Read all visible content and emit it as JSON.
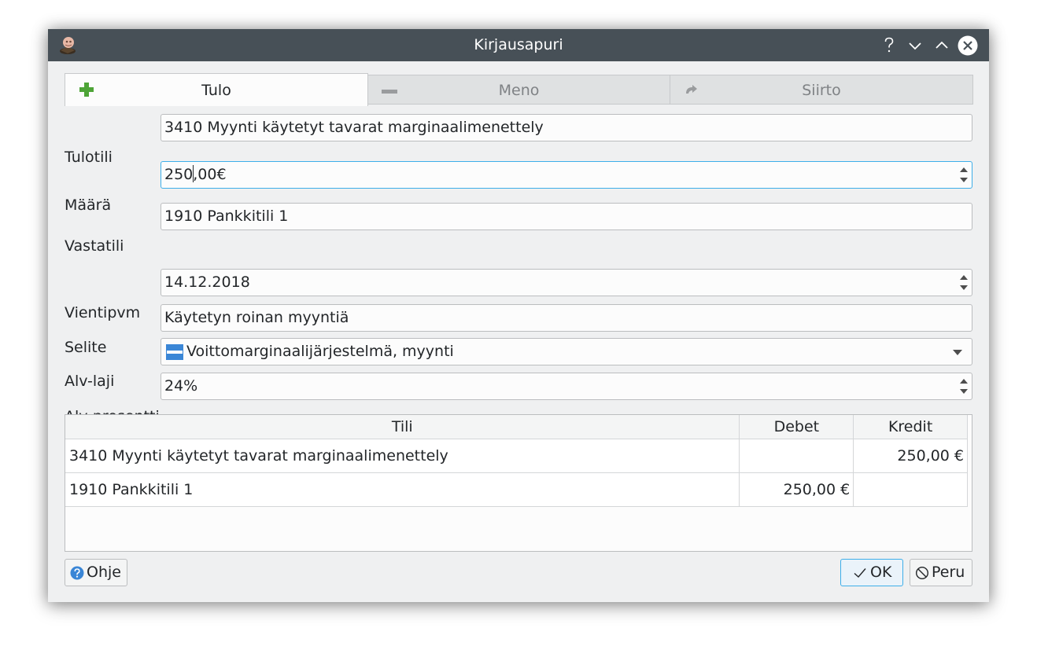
{
  "window": {
    "title": "Kirjausapuri",
    "controls": {
      "help": "?",
      "minimize": "chevron-down",
      "maximize": "chevron-up",
      "close": "close"
    }
  },
  "tabs": [
    {
      "label": "Tulo",
      "icon": "plus-icon",
      "active": true
    },
    {
      "label": "Meno",
      "icon": "minus-icon",
      "active": false
    },
    {
      "label": "Siirto",
      "icon": "transfer-icon",
      "active": false
    }
  ],
  "form": {
    "tulotili": {
      "label": "Tulotili",
      "value": "3410 Myynti käytetyt tavarat marginaalimenettely"
    },
    "maara": {
      "label": "Määrä",
      "value_before_cursor": "250",
      "value_after_cursor": ",00€"
    },
    "vastatili": {
      "label": "Vastatili",
      "value": "1910 Pankkitili 1"
    },
    "vientipvm": {
      "label": "Vientipvm",
      "value": "14.12.2018"
    },
    "selite": {
      "label": "Selite",
      "value": "Käytetyn roinan myyntiä"
    },
    "alv_laji": {
      "label": "Alv-laji",
      "value": "Voittomarginaalijärjestelmä, myynti"
    },
    "alv_prosentti": {
      "label": "Alv-prosentti",
      "value": "24%"
    }
  },
  "table": {
    "headers": [
      "Tili",
      "Debet",
      "Kredit"
    ],
    "rows": [
      {
        "tili": "3410 Myynti käytetyt tavarat marginaalimenettely",
        "debet": "",
        "kredit": "250,00 €"
      },
      {
        "tili": "1910 Pankkitili 1",
        "debet": "250,00 €",
        "kredit": ""
      }
    ]
  },
  "buttons": {
    "help": "Ohje",
    "ok": "OK",
    "cancel": "Peru"
  },
  "colors": {
    "titlebar": "#475057",
    "focus_accent": "#3daee9",
    "plus_green": "#4ea437",
    "window_bg": "#eff0f1"
  }
}
